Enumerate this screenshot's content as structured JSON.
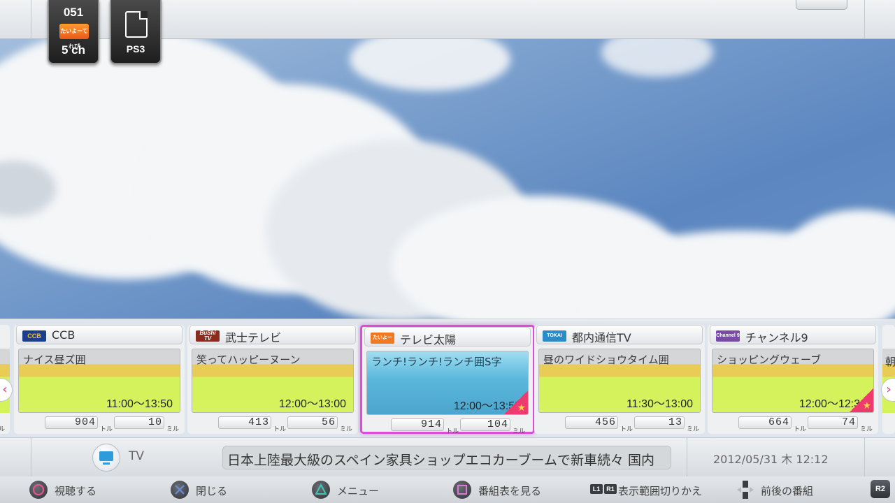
{
  "sources": [
    {
      "number": "051",
      "logo_text": "たいよーてれび",
      "channel": "5 ch"
    },
    {
      "label": "PS3",
      "icon": "ps3-device-icon"
    }
  ],
  "channels": [
    {
      "logo": "CCB",
      "logo_color": "#1e3d8f",
      "name": "CCB",
      "program": "ナイス昼ズ",
      "program_icon": "囲",
      "time": "11:00〜13:50",
      "stat1": "904",
      "unit1": "トル",
      "stat2": "10",
      "unit2": "ミル",
      "style": "yellow",
      "favorite": false
    },
    {
      "logo": "BuShi TV",
      "logo_color": "#8a2b1d",
      "name": "武士テレビ",
      "program": "笑ってハッピーヌーン",
      "program_icon": "",
      "time": "12:00〜13:00",
      "stat1": "413",
      "unit1": "トル",
      "stat2": "56",
      "unit2": "ミル",
      "style": "yellow",
      "favorite": false
    },
    {
      "logo": "たいよー",
      "logo_color": "#f07a22",
      "name": "テレビ太陽",
      "program": "ランチ!ランチ!ランチ",
      "program_icon": "囲S字",
      "time": "12:00〜13:55",
      "stat1": "914",
      "unit1": "トル",
      "stat2": "104",
      "unit2": "ミル",
      "style": "blue",
      "favorite": true,
      "selected": true
    },
    {
      "logo": "TOKAI",
      "logo_color": "#2a8bc6",
      "name": "都内通信TV",
      "program": "昼のワイドショウタイム",
      "program_icon": "囲",
      "time": "11:30〜13:00",
      "stat1": "456",
      "unit1": "トル",
      "stat2": "13",
      "unit2": "ミル",
      "style": "yellow",
      "favorite": false
    },
    {
      "logo": "Channel 9",
      "logo_color": "#7a4aa8",
      "name": "チャンネル9",
      "program": "ショッピングウェーブ",
      "program_icon": "",
      "time": "12:00〜12:30",
      "stat1": "664",
      "unit1": "トル",
      "stat2": "74",
      "unit2": "ミル",
      "style": "yellow",
      "favorite": true
    }
  ],
  "edge": {
    "left_unit": "ル",
    "right_char": "朝"
  },
  "nav": {
    "prev": "‹",
    "next": "›"
  },
  "info": {
    "mode": "TV",
    "ticker": "日本上陸最大級のスペイン家具ショップエコカーブームで新車続々 国内",
    "datetime": "2012/05/31 木 12:12"
  },
  "guide": [
    {
      "button": "circle",
      "label": "視聴する"
    },
    {
      "button": "cross",
      "label": "閉じる"
    },
    {
      "button": "triangle",
      "label": "メニュー"
    },
    {
      "button": "square",
      "label": "番組表を見る"
    },
    {
      "button": "L1 R1",
      "label": "表示範囲切りかえ"
    },
    {
      "button": "dpad-updown",
      "label": "前後の番組"
    },
    {
      "button": "R2",
      "label": "R2"
    }
  ],
  "colors": {
    "selected_border": "#d94fd4",
    "favorite_corner": "#ee3a6e",
    "icon_cross": "#6d8ad8",
    "icon_circle": "#e8538e",
    "icon_triangle": "#3bc9b8",
    "icon_square": "#d87ad8"
  }
}
